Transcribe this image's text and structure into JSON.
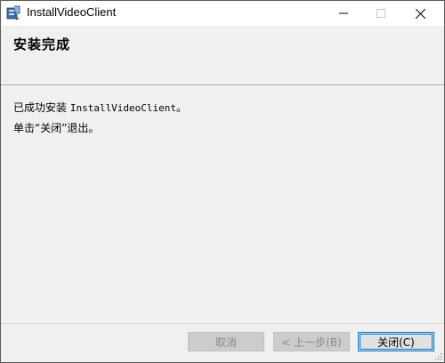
{
  "window": {
    "title": "InstallVideoClient",
    "controls": {
      "minimize": "—",
      "maximize": "☐",
      "close": "✕"
    }
  },
  "header": {
    "title": "安装完成"
  },
  "body": {
    "line1_prefix": "已成功安装 ",
    "line1_app": "InstallVideoClient",
    "line1_suffix": "。",
    "line2": "单击“关闭”退出。"
  },
  "buttons": {
    "cancel": "取消",
    "back": "< 上一步(B)",
    "close": "关闭(C)"
  }
}
